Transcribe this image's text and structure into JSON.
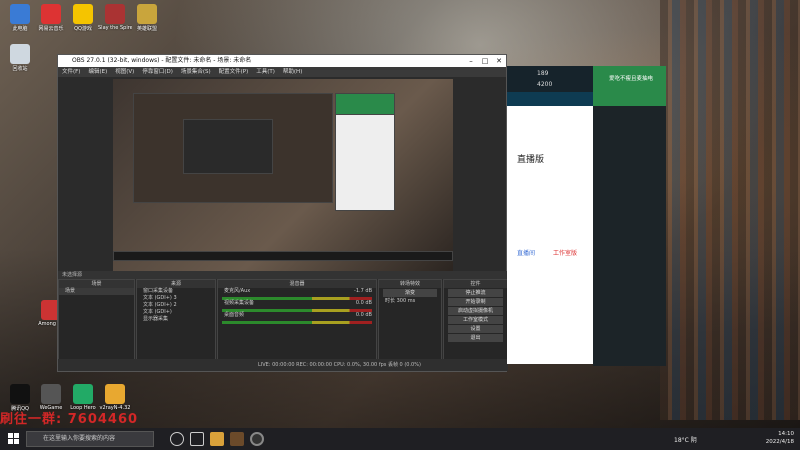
{
  "desktop_icons": [
    {
      "label": "此电脑",
      "color": "#3a7bd5"
    },
    {
      "label": "网易云音乐",
      "color": "#d33"
    },
    {
      "label": "QQ游戏",
      "color": "#f5c400"
    },
    {
      "label": "Slay the Spire",
      "color": "#a33"
    },
    {
      "label": "英雄联盟",
      "color": "#c9a53c"
    },
    {
      "label": "回收站",
      "color": "#cfd8e0"
    },
    {
      "label": "Among Us",
      "color": "#c33"
    },
    {
      "label": "WeGame",
      "color": "#555"
    },
    {
      "label": "Loop Hero",
      "color": "#2a6"
    },
    {
      "label": "v2rayN-4.32",
      "color": "#e8a830"
    },
    {
      "label": "腾讯QQ",
      "color": "#111"
    }
  ],
  "obs": {
    "title": "OBS 27.0.1 (32-bit, windows) - 配置文件: 未命名 - 场景: 未命名",
    "menu": [
      "文件(F)",
      "编辑(E)",
      "视图(V)",
      "停靠窗口(D)",
      "场景集合(S)",
      "配置文件(P)",
      "工具(T)",
      "帮助(H)"
    ],
    "scenes_header": "场景",
    "scene_item": "场景",
    "sources_header": "来源",
    "sources": [
      "窗口采集设备",
      "文本 (GDI+) 3",
      "文本 (GDI+) 2",
      "文本 (GDI+)",
      "显示器采集"
    ],
    "mixer_header": "混音器",
    "mixer": [
      {
        "name": "麦克风/Aux",
        "level": "-1.7 dB"
      },
      {
        "name": "视频采集设备",
        "level": "0.0 dB"
      },
      {
        "name": "桌面音频",
        "level": "0.0 dB"
      }
    ],
    "transition_header": "转场特效",
    "transition_type": "渐变",
    "duration_label": "时长",
    "duration_value": "300 ms",
    "controls_header": "控件",
    "controls": [
      "停止推流",
      "开始录制",
      "启动虚拟摄像机",
      "工作室模式",
      "设置",
      "退出"
    ],
    "no_source": "未选择源",
    "status": "LIVE: 00:00:00   REC: 00:00:00   CPU: 0.0%, 30.00 fps   丢帧 0 (0.0%)"
  },
  "web": {
    "heading": "直播版",
    "stats_viewers": "189",
    "stats_other": "4200",
    "chat_title": "爱吃不瘦且麦抽电",
    "button_blue": "直播间",
    "button_red": "工作室版"
  },
  "taskbar": {
    "search_placeholder": "在这里输入你要搜索的内容",
    "weather": "18°C 阴",
    "time": "14:10",
    "date": "2022/4/18"
  },
  "overlay": "刷往一群: 7604460"
}
